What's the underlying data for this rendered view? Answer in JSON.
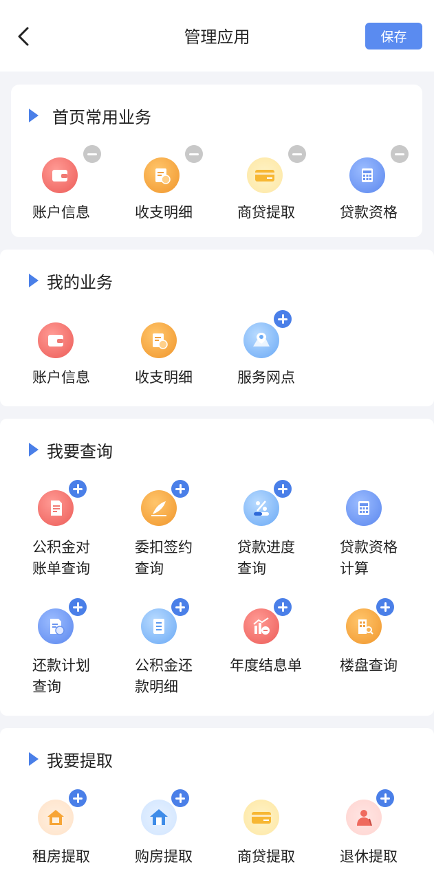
{
  "header": {
    "title": "管理应用",
    "save_label": "保存"
  },
  "sections": {
    "home": {
      "title": "首页常用业务",
      "items": [
        {
          "label": "账户信息",
          "icon": "wallet-icon",
          "action": "remove"
        },
        {
          "label": "收支明细",
          "icon": "bill-icon",
          "action": "remove"
        },
        {
          "label": "商贷提取",
          "icon": "card-icon",
          "action": "remove"
        },
        {
          "label": "贷款资格",
          "icon": "calculator-icon",
          "action": "remove"
        }
      ]
    },
    "mine": {
      "title": "我的业务",
      "items": [
        {
          "label": "账户信息",
          "icon": "wallet-icon",
          "action": "none"
        },
        {
          "label": "收支明细",
          "icon": "bill-icon",
          "action": "none"
        },
        {
          "label": "服务网点",
          "icon": "map-pin-icon",
          "action": "add"
        }
      ]
    },
    "query": {
      "title": "我要查询",
      "items": [
        {
          "label": "公积金对\n账单查询",
          "icon": "statement-icon",
          "action": "add"
        },
        {
          "label": "委扣签约\n查询",
          "icon": "pen-icon",
          "action": "add"
        },
        {
          "label": "贷款进度\n查询",
          "icon": "percent-icon",
          "action": "add"
        },
        {
          "label": "贷款资格\n计算",
          "icon": "calculator-icon",
          "action": "none"
        },
        {
          "label": "还款计划\n查询",
          "icon": "repay-plan-icon",
          "action": "add"
        },
        {
          "label": "公积金还\n款明细",
          "icon": "document-icon",
          "action": "add"
        },
        {
          "label": "年度结息单",
          "icon": "annual-chart-icon",
          "action": "add"
        },
        {
          "label": "楼盘查询",
          "icon": "building-search-icon",
          "action": "add"
        }
      ]
    },
    "withdraw": {
      "title": "我要提取",
      "items": [
        {
          "label": "租房提取",
          "icon": "rent-house-icon",
          "action": "add"
        },
        {
          "label": "购房提取",
          "icon": "buy-house-icon",
          "action": "add"
        },
        {
          "label": "商贷提取",
          "icon": "card-icon",
          "action": "none"
        },
        {
          "label": "退休提取",
          "icon": "retiree-icon",
          "action": "add"
        }
      ]
    }
  },
  "colors": {
    "accent": "#4a7fe8",
    "save_button": "#5a8bf0",
    "remove_badge": "#c8c8c8"
  }
}
